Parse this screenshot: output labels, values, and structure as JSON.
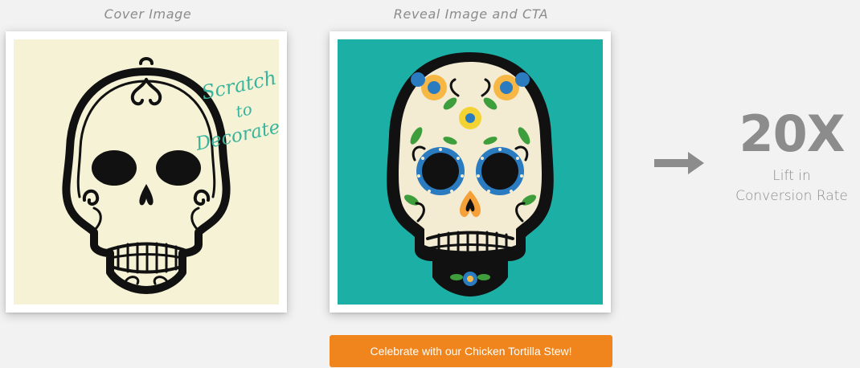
{
  "cover": {
    "caption": "Cover Image",
    "overlay_lines": [
      "Scratch",
      "to",
      "Decorate!"
    ],
    "background_color": "#f5f2d6",
    "overlay_color": "#39b49c"
  },
  "reveal": {
    "caption": "Reveal Image and CTA",
    "background_color": "#1bafa5",
    "cta_label": "Celebrate with our Chicken Tortilla Stew!",
    "cta_color": "#f0851e"
  },
  "stat": {
    "value": "20X",
    "label_line1": "Lift in",
    "label_line2": "Conversion Rate"
  },
  "icons": {
    "arrow": "arrow-right-icon"
  }
}
